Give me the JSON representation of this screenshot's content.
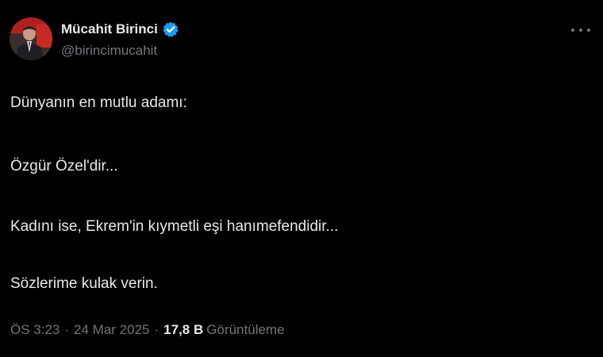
{
  "author": {
    "name": "Mücahit Birinci",
    "handle": "@birincimucahit",
    "verified_color": "#1d9bf0"
  },
  "tweet": {
    "lines": [
      "Dünyanın en mutlu adamı:",
      "Özgür Özel'dir...",
      "Kadını ise, Ekrem'in kıymetli eşi hanımefendidir...",
      "Sözlerime kulak verin."
    ]
  },
  "meta": {
    "time": "ÖS 3:23",
    "separator": "·",
    "date": "24 Mar 2025",
    "views_count": "17,8 B",
    "views_label": "Görüntüleme"
  },
  "icons": {
    "more": "more-options-icon",
    "verified": "verified-badge-icon"
  },
  "colors": {
    "background": "#000000",
    "text_primary": "#e7e9ea",
    "text_secondary": "#71767b",
    "accent": "#1d9bf0"
  }
}
